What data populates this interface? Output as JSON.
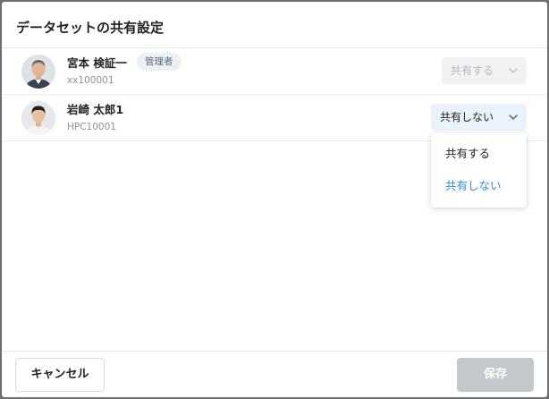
{
  "dialog": {
    "title": "データセットの共有設定",
    "cancel_label": "キャンセル",
    "save_label": "保存"
  },
  "users": [
    {
      "name": "宮本 検証一",
      "badge": "管理者",
      "id": "xx100001",
      "share_value": "共有する",
      "share_disabled": true
    },
    {
      "name": "岩崎 太郎1",
      "id": "HPC10001",
      "share_value": "共有しない",
      "share_disabled": false
    }
  ],
  "share_menu": {
    "options": [
      "共有する",
      "共有しない"
    ],
    "selected": "共有しない"
  },
  "colors": {
    "accent": "#2d8fe0",
    "select_active_bg": "#eaf3fb",
    "save_disabled_bg": "#c4c7cb",
    "badge_bg": "#eef1f4"
  },
  "icons": {
    "avatar_0": "avatar-photo-older-man",
    "avatar_1": "avatar-photo-young-man",
    "dropdown": "chevron-down-icon"
  }
}
